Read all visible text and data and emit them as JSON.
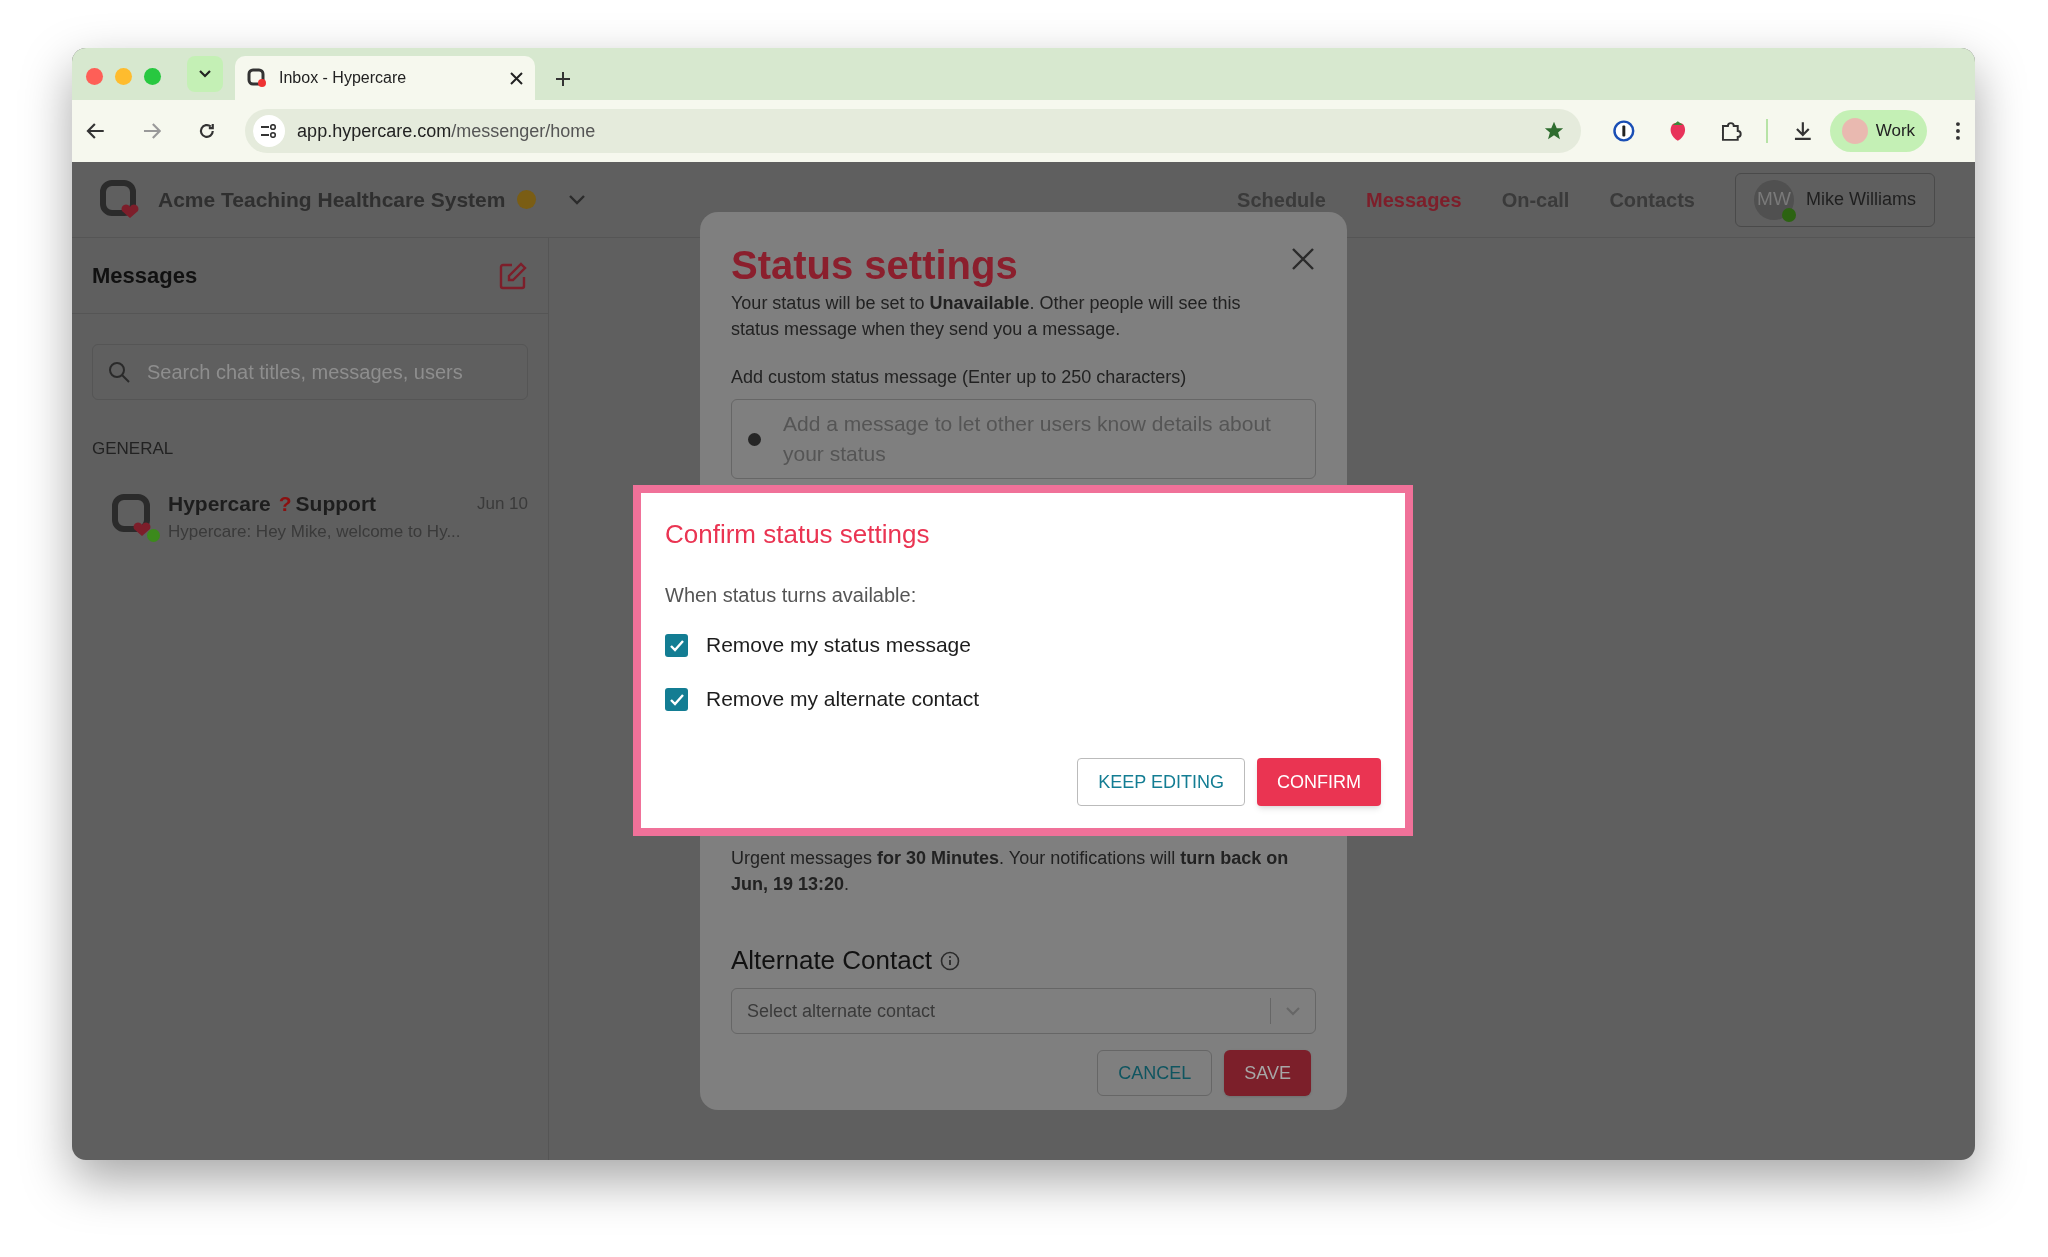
{
  "browser": {
    "tab": {
      "title": "Inbox - Hypercare"
    },
    "url": {
      "host": "app.hypercare.com",
      "path": "/messenger/home"
    },
    "profile": "Work"
  },
  "app": {
    "org_name": "Acme Teaching Healthcare System",
    "nav": [
      {
        "label": "Schedule",
        "selected": false
      },
      {
        "label": "Messages",
        "selected": true
      },
      {
        "label": "On-call",
        "selected": false
      },
      {
        "label": "Contacts",
        "selected": false
      }
    ],
    "user": {
      "initials": "MW",
      "name": "Mike Williams",
      "online": true
    }
  },
  "sidebar": {
    "title": "Messages",
    "search": {
      "placeholder": "Search chat titles, messages, users"
    },
    "section": "GENERAL",
    "chats": [
      {
        "name": "Hypercare",
        "badge": "?",
        "name_suffix": "Support",
        "date": "Jun 10",
        "preview": "Hypercare: Hey Mike, welcome to Hy...",
        "online": true
      }
    ]
  },
  "status_modal": {
    "title": "Status settings",
    "description": "Your status will be set to **Unavailable**. Other people will see this status message when they send you a message.",
    "message_label": "Add custom status message (Enter up to 250 characters)",
    "message_placeholder": "Add a message to let other users know details about your status",
    "notice": "Urgent messages **for 30 Minutes**. Your notifications will **turn back on Jun, 19 13:20**.",
    "alternate_contact_title": "Alternate Contact",
    "alternate_contact_placeholder": "Select alternate contact",
    "buttons": [
      {
        "label": "CANCEL",
        "kind": "secondary"
      },
      {
        "label": "SAVE",
        "kind": "primary"
      }
    ]
  },
  "confirm_dialog": {
    "title": "Confirm status settings",
    "prompt": "When status turns available:",
    "options": [
      {
        "label": "Remove my status message",
        "checked": true
      },
      {
        "label": "Remove my alternate contact",
        "checked": true
      }
    ],
    "buttons": [
      {
        "label": "KEEP EDITING",
        "kind": "secondary"
      },
      {
        "label": "CONFIRM",
        "kind": "primary"
      }
    ]
  }
}
